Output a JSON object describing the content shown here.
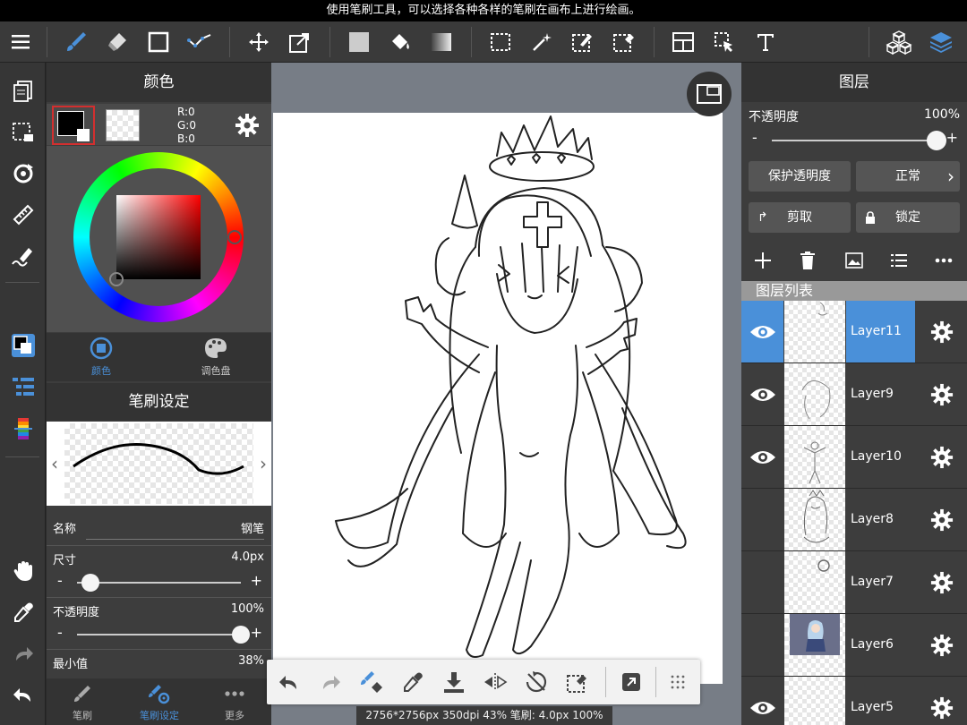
{
  "tip": "使用笔刷工具，可以选择各种各样的笔刷在画布上进行绘画。",
  "color_panel": {
    "title": "颜色",
    "rgb": {
      "r": "R:0",
      "g": "G:0",
      "b": "B:0"
    },
    "tab_color": "颜色",
    "tab_palette": "调色盘"
  },
  "brush_panel": {
    "title": "笔刷设定",
    "name_label": "名称",
    "name_value": "钢笔",
    "size_label": "尺寸",
    "size_value": "4.0px",
    "size_level": 0.08,
    "opacity_label": "不透明度",
    "opacity_value": "100%",
    "opacity_level": 1.0,
    "min_label": "最小值",
    "min_value": "38%",
    "minus": "-",
    "plus": "+"
  },
  "bottom_tabs": [
    {
      "label": "笔刷",
      "icon": "brush-icon"
    },
    {
      "label": "笔刷设定",
      "icon": "brush-settings-icon"
    },
    {
      "label": "更多",
      "icon": "more-icon"
    }
  ],
  "status": "2756*2756px 350dpi 43% 笔刷: 4.0px 100%",
  "layers_panel": {
    "title": "图层",
    "opacity_label": "不透明度",
    "opacity_value": "100%",
    "opacity_level": 1.0,
    "protect_label": "保护透明度",
    "blend_label": "正常",
    "clip_label": "剪取",
    "lock_label": "锁定",
    "list_title": "图层列表",
    "minus": "-",
    "plus": "+",
    "layers": [
      {
        "name": "Layer11",
        "visible": true,
        "selected": true
      },
      {
        "name": "Layer9",
        "visible": true,
        "selected": false
      },
      {
        "name": "Layer10",
        "visible": true,
        "selected": false
      },
      {
        "name": "Layer8",
        "visible": false,
        "selected": false
      },
      {
        "name": "Layer7",
        "visible": false,
        "selected": false
      },
      {
        "name": "Layer6",
        "visible": false,
        "selected": false
      },
      {
        "name": "Layer5",
        "visible": true,
        "selected": false
      }
    ]
  },
  "colors": {
    "accent": "#4a90d9",
    "selected_layer": "#4a90d9",
    "foreground": "#000000",
    "swatch_border": "#d32f2f"
  }
}
